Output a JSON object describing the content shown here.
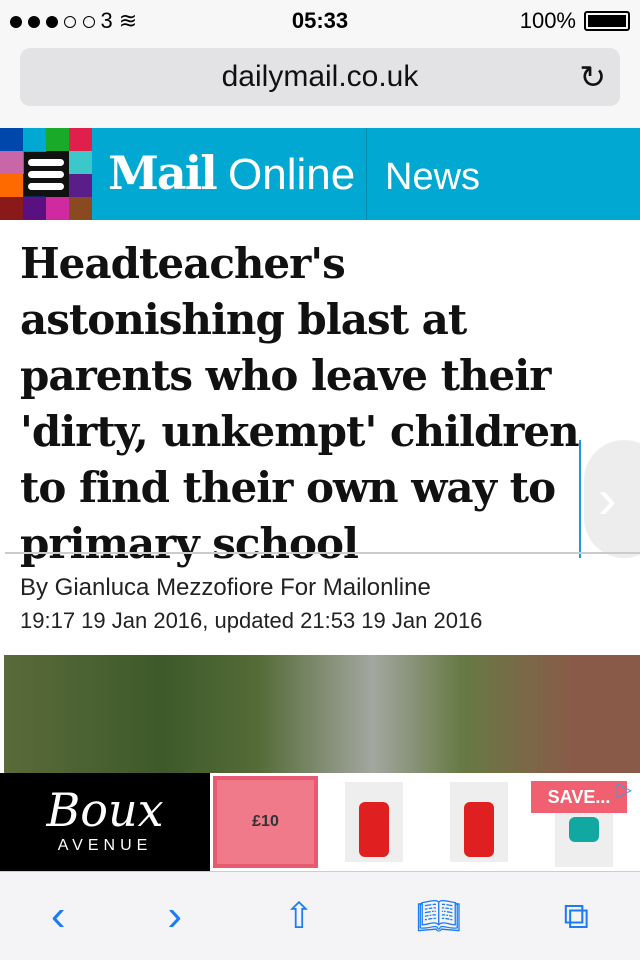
{
  "status": {
    "carrier": "3",
    "time": "05:33",
    "battery": "100%"
  },
  "browser": {
    "url": "dailymail.co.uk"
  },
  "header": {
    "logo_mail": "Mail",
    "logo_online": "Online",
    "section": "News",
    "grid_colors": [
      "#0047ab",
      "#00a8d2",
      "#1aaa2a",
      "#e0204a",
      "#c866a8",
      "#6e6e6e",
      "#111",
      "#3cc8c8",
      "#ff6a00",
      "#0d2a5a",
      "#111",
      "#5a1e8a",
      "#8a1a1a",
      "#5a1080",
      "#d02aa0",
      "#8a4a20"
    ]
  },
  "article": {
    "headline": "Headteacher's astonishing blast at parents who leave their 'dirty, unkempt' children to find their own way to primary school",
    "byline": "By Gianluca Mezzofiore For Mailonline",
    "date": "19:17 19 Jan 2016, updated 21:53 19 Jan 2016"
  },
  "ad": {
    "brand": "Boux",
    "brand_sub": "AVENUE",
    "price": "£10",
    "save": "SAVE..."
  }
}
